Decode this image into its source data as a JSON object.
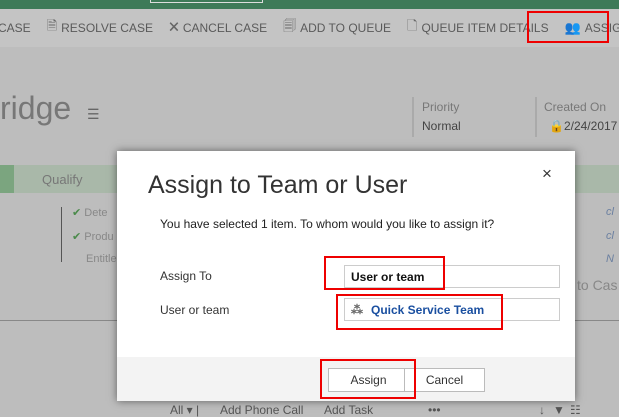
{
  "toolbar": {
    "items": [
      {
        "label": "CASE",
        "icon": "case-icon"
      },
      {
        "label": "RESOLVE CASE",
        "icon": "resolve-icon"
      },
      {
        "label": "CANCEL CASE",
        "icon": "cancel-icon"
      },
      {
        "label": "ADD TO QUEUE",
        "icon": "queue-add-icon"
      },
      {
        "label": "QUEUE ITEM DETAILS",
        "icon": "queue-details-icon"
      },
      {
        "label": "ASSIGN",
        "icon": "assign-icon"
      }
    ]
  },
  "record": {
    "title": "ridge",
    "priority_label": "Priority",
    "priority_value": "Normal",
    "created_label": "Created On",
    "created_value": "2/24/2017"
  },
  "process": {
    "stage": "Qualify",
    "steps": [
      "Dete",
      "Produ",
      "Entitle"
    ],
    "right": [
      "cl",
      "cl",
      "N",
      "to Cas"
    ]
  },
  "dialog": {
    "title": "Assign to Team or User",
    "message": "You have selected 1 item. To whom would you like to assign it?",
    "assign_to_label": "Assign To",
    "assign_to_value": "User or team",
    "user_team_label": "User or team",
    "user_team_value": "Quick Service Team",
    "assign_button": "Assign",
    "cancel_button": "Cancel",
    "close": "×"
  },
  "bottom": {
    "filter": "All",
    "add_phone": "Add Phone Call",
    "add_task": "Add Task",
    "more": "•••"
  }
}
